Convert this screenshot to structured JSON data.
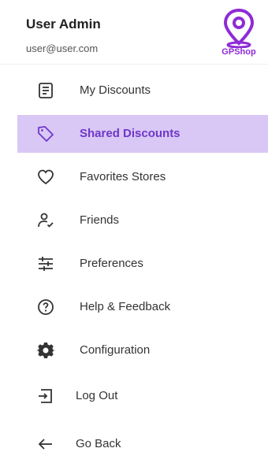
{
  "header": {
    "user_name": "User Admin",
    "user_email": "user@user.com",
    "logo_text": "GPShop"
  },
  "colors": {
    "accent": "#8e2bd6",
    "active_bg": "#d9c7f5",
    "active_text": "#6f37c9"
  },
  "menu": {
    "items": [
      {
        "label": "My Discounts",
        "icon": "document-icon",
        "active": false
      },
      {
        "label": "Shared Discounts",
        "icon": "tag-icon",
        "active": true
      },
      {
        "label": "Favorites Stores",
        "icon": "heart-icon",
        "active": false
      },
      {
        "label": "Friends",
        "icon": "person-check-icon",
        "active": false
      },
      {
        "label": "Preferences",
        "icon": "sliders-icon",
        "active": false
      },
      {
        "label": "Help & Feedback",
        "icon": "help-circle-icon",
        "active": false
      },
      {
        "label": "Configuration",
        "icon": "gear-icon",
        "active": false
      },
      {
        "label": "Log Out",
        "icon": "logout-icon",
        "active": false
      },
      {
        "label": "Go Back",
        "icon": "arrow-left-icon",
        "active": false
      }
    ]
  }
}
